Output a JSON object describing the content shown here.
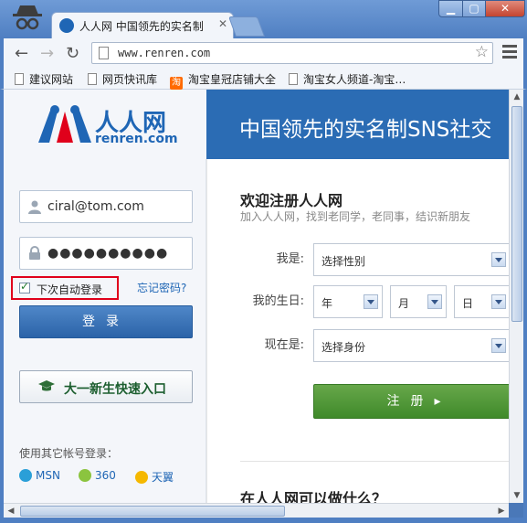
{
  "browser": {
    "tab_title": "人人网 中国领先的实名制",
    "url": "www.renren.com",
    "window_controls": {
      "minimize": "▁",
      "maximize": "▢",
      "close": "✕"
    },
    "bookmarks": [
      "建议网站",
      "网页快讯库",
      "淘宝皇冠店铺大全",
      "淘宝女人频道-淘宝…"
    ],
    "bookmark_taobao_glyph": "淘"
  },
  "header": {
    "logo_cn": "人人网",
    "logo_en": "renren.com",
    "slogan": "中国领先的实名制SNS社交"
  },
  "login": {
    "email_value": "ciral@tom.com",
    "password_mask": "●●●●●●●●●●",
    "remember_label": "下次自动登录",
    "forgot_label": "忘记密码?",
    "login_button": "登录",
    "freshman_button": "大一新生快速入口",
    "other_login_label": "使用其它帐号登录：",
    "providers": [
      "MSN",
      "360",
      "天翼"
    ]
  },
  "register": {
    "title": "欢迎注册人人网",
    "subtitle": "加入人人网，找到老同学，老同事，结识新朋友",
    "gender_label": "我是:",
    "gender_value": "选择性别",
    "birthday_label": "我的生日:",
    "year_value": "年",
    "month_value": "月",
    "day_value": "日",
    "status_label": "现在是:",
    "status_value": "选择身份",
    "register_button": "注册",
    "register_arrow": "▸",
    "what_title": "在人人网可以做什么？"
  },
  "colors": {
    "brand_blue": "#1f66b5",
    "highlight_red": "#e0001b",
    "register_green": "#4f9836"
  }
}
